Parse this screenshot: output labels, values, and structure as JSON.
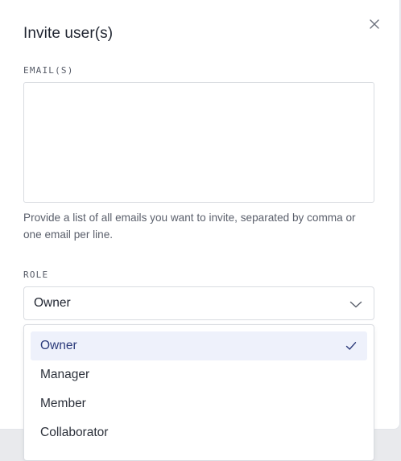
{
  "dialog": {
    "title": "Invite user(s)",
    "close_icon": "close-icon"
  },
  "emails": {
    "label": "EMAIL(S)",
    "value": "",
    "placeholder": "",
    "help": "Provide a list of all emails you want to invite, separated by comma or one email per line."
  },
  "role": {
    "label": "ROLE",
    "selected": "Owner",
    "chevron_icon": "chevron-down-icon",
    "options": [
      {
        "label": "Owner",
        "selected": true
      },
      {
        "label": "Manager",
        "selected": false
      },
      {
        "label": "Member",
        "selected": false
      },
      {
        "label": "Collaborator",
        "selected": false
      }
    ]
  },
  "colors": {
    "selected_bg": "#eef1fb",
    "selected_text": "#2b3a7a",
    "border": "#d9dce1",
    "backdrop": "#e9eaed"
  }
}
